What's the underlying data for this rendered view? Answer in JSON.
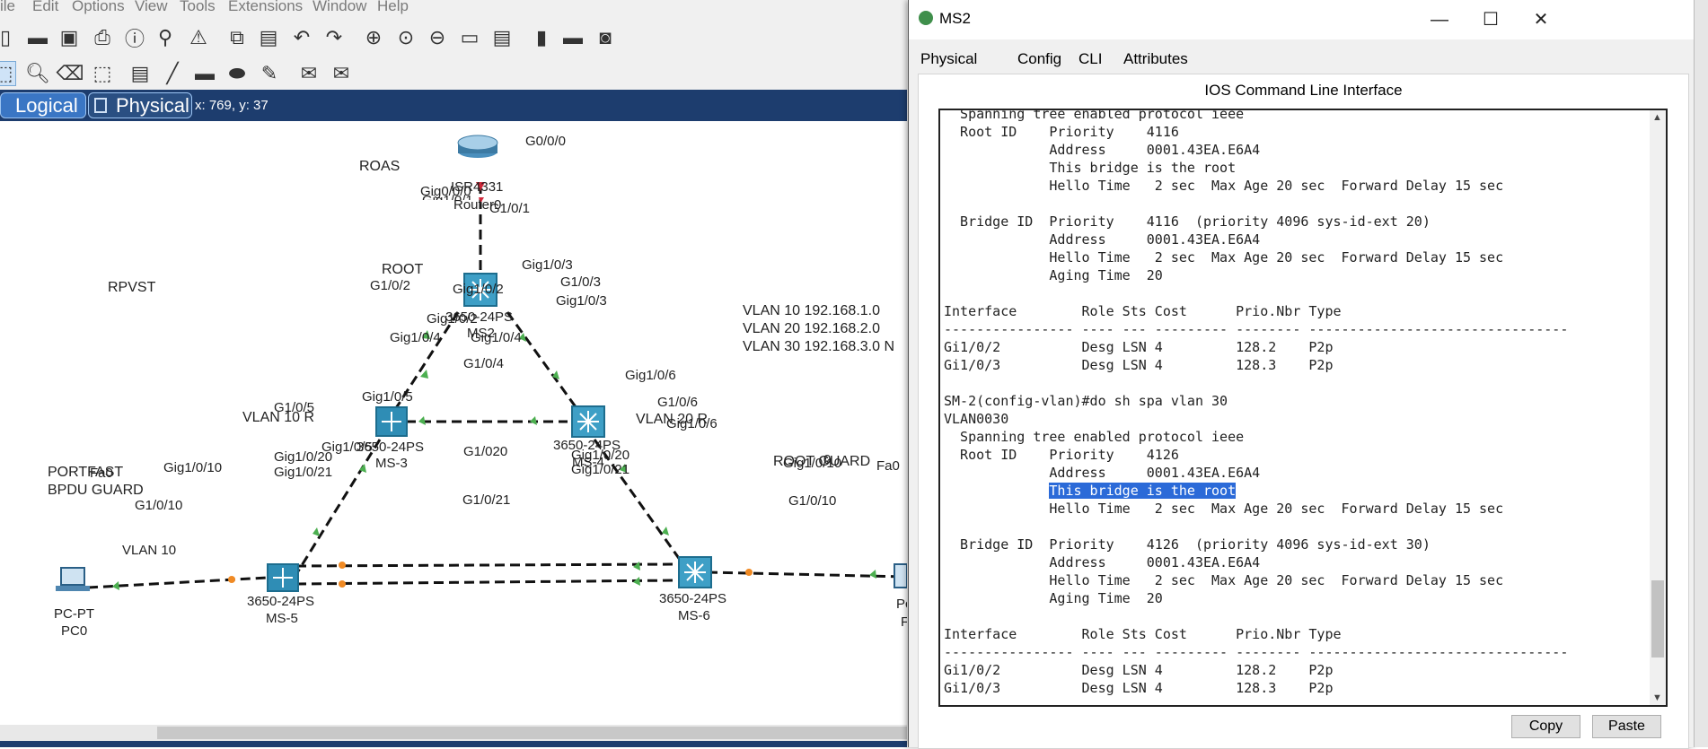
{
  "menu": [
    "ile",
    "Edit",
    "Options",
    "View",
    "Tools",
    "Extensions",
    "Window",
    "Help"
  ],
  "view_tabs": {
    "logical": "Logical",
    "physical": "Physical",
    "coords": "x: 769, y: 37"
  },
  "topology": {
    "notes": {
      "roas": "ROAS",
      "rpvst": "RPVST",
      "root": "ROOT",
      "vlan10_root": "VLAN 10 R",
      "vlan20_root": "VLAN 20 R",
      "portfast": "PORTFAST",
      "bpdu_guard": "BPDU GUARD",
      "root_guard": "ROOT GUARD",
      "vlan_ips": [
        "VLAN 10 192.168.1.0",
        "VLAN 20 192.168.2.0",
        "VLAN 30 192.168.3.0 N"
      ],
      "vlan10_left": "VLAN 10"
    },
    "devices": {
      "router": {
        "model": "ISR4331",
        "name": "Router0"
      },
      "ms2": {
        "model": "3650-24PS",
        "name": "MS2"
      },
      "ms3": {
        "model": "3650-24PS",
        "name": "MS-3"
      },
      "ms4": {
        "model": "3650-24PS",
        "name": "MS-4"
      },
      "ms5": {
        "model": "3650-24PS",
        "name": "MS-5"
      },
      "ms6": {
        "model": "3650-24PS",
        "name": "MS-6"
      },
      "pc0": {
        "model": "PC-PT",
        "name": "PC0"
      }
    },
    "ports": {
      "g000": "G0/0/0",
      "gig000": "Gig0/0/0",
      "gig101_cut": "Gig1/0/1",
      "g101": "G1/0/1",
      "gig103_a": "Gig1/0/3",
      "g103": "G1/0/3",
      "gig103_b": "Gig1/0/3",
      "g102": "G1/0/2",
      "gig102_a": "Gig1/0/2",
      "gig102_b": "Gig1/0/2",
      "gig104_a": "Gig1/0/4",
      "gig104_b": "Gig1/0/4",
      "g104": "G1/0/4",
      "gig105_a": "Gig1/0/5",
      "g105": "G1/0/5",
      "gig105_b": "Gig1/0/5",
      "gig106_a": "Gig1/0/6",
      "g106": "G1/0/6",
      "gig106_b": "Gig1/0/6",
      "gig1020_a": "Gig1/0/20",
      "gig1021_a": "Gig1/0/21",
      "g1020": "G1/020",
      "g1021": "G1/0/21",
      "gig1020_b": "Gig1/0/20",
      "gig1021_b": "Gig1/0/21",
      "gig1010_a": "Gig1/0/10",
      "g1010_a": "G1/0/10",
      "fa0_a": "Fa0",
      "gig1010_b": "Gig1/0/10",
      "g1010_b": "G1/0/10",
      "fa0_b": "Fa0",
      "partial_10": "0",
      "partial_pc": "Pc",
      "partial_p": "F"
    }
  },
  "ms2_window": {
    "title": "MS2",
    "controls": {
      "minimize": "—",
      "maximize": "☐",
      "close": "✕"
    },
    "tabs": [
      "Physical",
      "Config",
      "CLI",
      "Attributes"
    ],
    "active_tab": "CLI",
    "heading": "IOS Command Line Interface",
    "cli_before": "  Spanning tree enabled protocol ieee\n  Root ID    Priority    4116\n             Address     0001.43EA.E6A4\n             This bridge is the root\n             Hello Time   2 sec  Max Age 20 sec  Forward Delay 15 sec\n\n  Bridge ID  Priority    4116  (priority 4096 sys-id-ext 20)\n             Address     0001.43EA.E6A4\n             Hello Time   2 sec  Max Age 20 sec  Forward Delay 15 sec\n             Aging Time  20\n\nInterface        Role Sts Cost      Prio.Nbr Type\n---------------- ---- --- --------- -------- --------------------------------\nGi1/0/2          Desg LSN 4         128.2    P2p\nGi1/0/3          Desg LSN 4         128.3    P2p\n\nSM-2(config-vlan)#do sh spa vlan 30\nVLAN0030\n  Spanning tree enabled protocol ieee\n  Root ID    Priority    4126\n             Address     0001.43EA.E6A4\n             ",
    "cli_selected": "This bridge is the root",
    "cli_after": "\n             Hello Time   2 sec  Max Age 20 sec  Forward Delay 15 sec\n\n  Bridge ID  Priority    4126  (priority 4096 sys-id-ext 30)\n             Address     0001.43EA.E6A4\n             Hello Time   2 sec  Max Age 20 sec  Forward Delay 15 sec\n             Aging Time  20\n\nInterface        Role Sts Cost      Prio.Nbr Type\n---------------- ---- --- --------- -------- --------------------------------\nGi1/0/2          Desg LSN 4         128.2    P2p\nGi1/0/3          Desg LSN 4         128.3    P2p",
    "buttons": {
      "copy": "Copy",
      "paste": "Paste"
    }
  },
  "colors": {
    "accent": "#0a64c8",
    "viewbar": "#1d3d6e",
    "selection": "#2b6ad8",
    "link_up": "#4caf50",
    "link_amber": "#f08a24"
  }
}
